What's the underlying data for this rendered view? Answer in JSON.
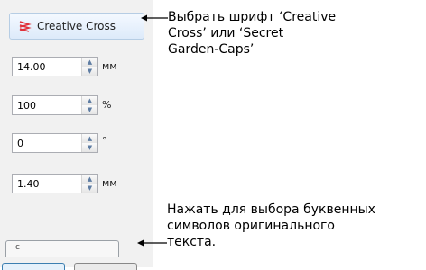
{
  "font_selector": {
    "font_name": "Creative Cross",
    "icon": "font-type-icon"
  },
  "fields": [
    {
      "value": "14.00",
      "unit": "мм"
    },
    {
      "value": "100",
      "unit": "%"
    },
    {
      "value": "0",
      "unit": "°"
    },
    {
      "value": "1.40",
      "unit": "мм"
    }
  ],
  "lower_box_text": "с",
  "callouts": {
    "font_choice": "Выбрать шрифт ‘Creative\nCross’ или ‘Secret\nGarden-Caps’",
    "letter_selection": "Нажать для выбора буквенных\nсимволов оригинального\nтекста."
  },
  "colors": {
    "panel_bg": "#f1f1f1",
    "combo_border": "#b6cde4",
    "font_icon": "#e0303a",
    "spin_arrow": "#5f7da3"
  }
}
